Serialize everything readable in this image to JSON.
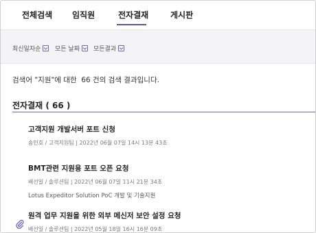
{
  "tabs": [
    {
      "label": "전체검색"
    },
    {
      "label": "임직원"
    },
    {
      "label": "전자결재",
      "active": true
    },
    {
      "label": "게시판"
    }
  ],
  "filters": [
    {
      "label": "최신일자순"
    },
    {
      "label": "모든 날짜"
    },
    {
      "label": "모든결과"
    }
  ],
  "summary": "검색어 \"지원\"에 대한  66 건의 검색 결과입니다.",
  "section": {
    "title": "전자결재 ( 66 )"
  },
  "results": [
    {
      "title": "고객지원 개발서버 포트 신청",
      "meta": "송민호 / 고객지원팀 | 2022년 06월 07일 14시 13분 43초",
      "description": ""
    },
    {
      "title": "BMT관련 지원용 포트 오픈 요청",
      "meta": "배선일 / 솔루션팀 | 2022년 06월 07일 11시 21분 34초",
      "description": "Lotus Expeditor Solution PoC 개발 및 기술지원"
    },
    {
      "title": "원격 업무 지원을 위한 외부 메신저 보안 설정 요청",
      "meta": "배선일 / 솔루션팀 | 2022년 05월 18일 16시 16분 09초",
      "description": "",
      "attachment": true
    }
  ],
  "colors": {
    "accent": "#5b4db0",
    "filterbar_bg": "#f4f4f7"
  },
  "icons": {
    "dropdown": "chevron-down-icon",
    "attachment": "paperclip-icon"
  }
}
